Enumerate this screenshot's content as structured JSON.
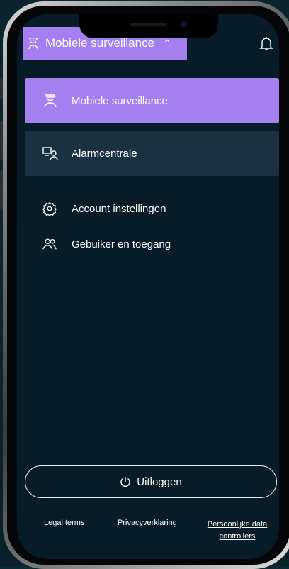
{
  "header": {
    "title": "Mobiele surveillance"
  },
  "menu": {
    "items": [
      {
        "label": "Mobiele surveillance",
        "icon": "guard-icon"
      },
      {
        "label": "Alarmcentrale",
        "icon": "monitor-user-icon"
      }
    ],
    "settings": [
      {
        "label": "Account instellingen",
        "icon": "gear-icon"
      },
      {
        "label": "Gebuiker en toegang",
        "icon": "users-icon"
      }
    ]
  },
  "logout_label": "Uitloggen",
  "footer": {
    "legal": "Legal terms",
    "privacy": "Privacyverklaring",
    "personal_data": "Persoonlijke data controllers"
  },
  "colors": {
    "accent": "#a47ff0",
    "background": "#071c26",
    "card": "#1a3140"
  }
}
